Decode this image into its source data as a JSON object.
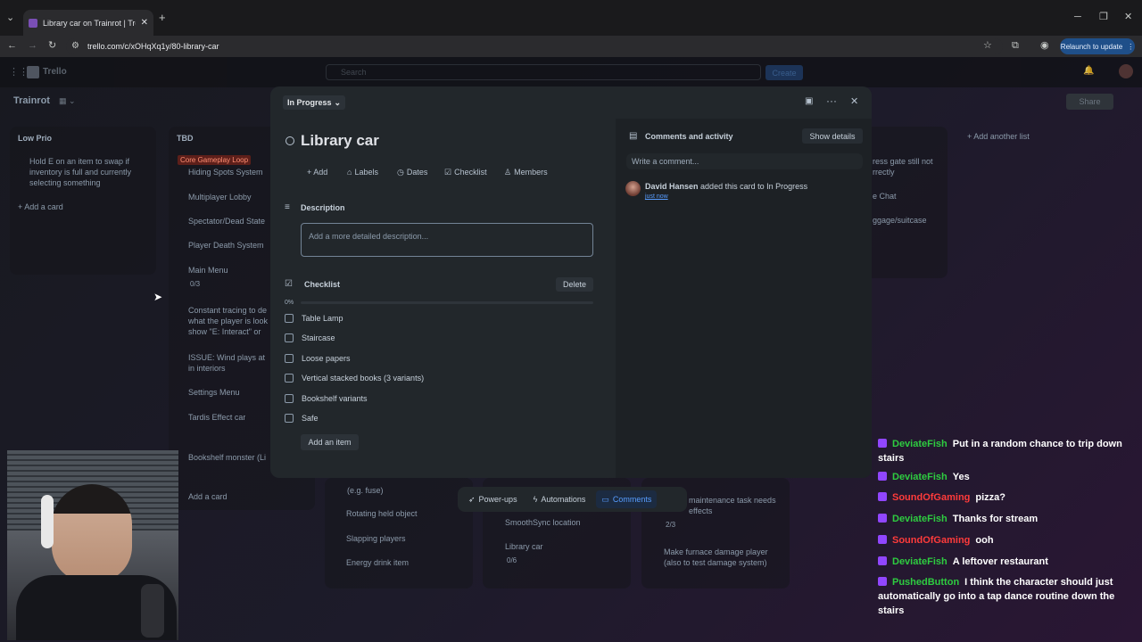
{
  "browser": {
    "tab_title": "Library car on Trainrot | Trello",
    "url": "trello.com/c/xOHqXq1y/80-library-car",
    "relaunch_label": "Relaunch to update"
  },
  "trello": {
    "logo_text": "Trello",
    "search_placeholder": "Search",
    "create_label": "Create",
    "board_name": "Trainrot",
    "share_label": "Share",
    "add_list_label": "+ Add another list",
    "lists": [
      {
        "title": "Low Prio",
        "cards": [
          "Hold E on an item to swap if",
          "inventory is full and currently",
          "selecting something"
        ],
        "add_label": "+ Add a card"
      },
      {
        "title": "TBD",
        "label_tag": "Core Gameplay Loop",
        "cards": [
          "Hiding Spots System",
          "Multiplayer Lobby",
          "Spectator/Dead State",
          "Player Death System",
          "Main Menu",
          "0/3",
          "Constant tracing to de",
          "what the player is look",
          "show \"E: Interact\" or",
          "ISSUE: Wind plays at",
          "in interiors",
          "Settings Menu",
          "Tardis Effect car",
          "Bookshelf monster (Li"
        ],
        "add_label": "Add a card"
      }
    ],
    "behind_cards": [
      "(e.g. fuse)",
      "Rotating held object",
      "Slapping players",
      "Energy drink item",
      "SmoothSync location",
      "Library car",
      "0/6",
      "Make furnace damage player",
      "(also to test damage system)",
      "maintenance task needs",
      "effects",
      "2/3",
      "ress gate still not",
      "rrectly",
      "e Chat",
      "ggage/suitcase"
    ]
  },
  "card": {
    "status": "In Progress",
    "title": "Library car",
    "actions": [
      "+ Add",
      "Labels",
      "Dates",
      "Checklist",
      "Members"
    ],
    "description_heading": "Description",
    "description_placeholder": "Add a more detailed description...",
    "checklist": {
      "heading": "Checklist",
      "delete_label": "Delete",
      "progress_label": "0%",
      "progress": 0,
      "items": [
        "Table Lamp",
        "Staircase",
        "Loose papers",
        "Vertical stacked books (3 variants)",
        "Bookshelf variants",
        "Safe"
      ],
      "add_item_label": "Add an item"
    },
    "comments": {
      "heading": "Comments and activity",
      "show_details_label": "Show details",
      "input_placeholder": "Write a comment...",
      "activity_user": "David Hansen",
      "activity_text": "added this card to In Progress",
      "activity_time": "just now"
    }
  },
  "toolbar": {
    "powerups": "Power-ups",
    "automations": "Automations",
    "comments": "Comments"
  },
  "chat": [
    {
      "user": "DeviateFish",
      "color": "#2ecc40",
      "message": "Put in a random chance to trip down stairs"
    },
    {
      "user": "DeviateFish",
      "color": "#2ecc40",
      "message": "Yes"
    },
    {
      "user": "SoundOfGaming",
      "color": "#ff3b3b",
      "message": "pizza?"
    },
    {
      "user": "DeviateFish",
      "color": "#2ecc40",
      "message": "Thanks for stream"
    },
    {
      "user": "SoundOfGaming",
      "color": "#ff3b3b",
      "message": "ooh"
    },
    {
      "user": "DeviateFish",
      "color": "#2ecc40",
      "message": "A leftover restaurant"
    },
    {
      "user": "PushedButton",
      "color": "#2ecc40",
      "message": "I think the character should just automatically go into a tap dance routine down the stairs"
    }
  ],
  "colors": {
    "accent": "#579dff",
    "modal_bg": "#22272b",
    "chat_badge": "#9146ff"
  }
}
